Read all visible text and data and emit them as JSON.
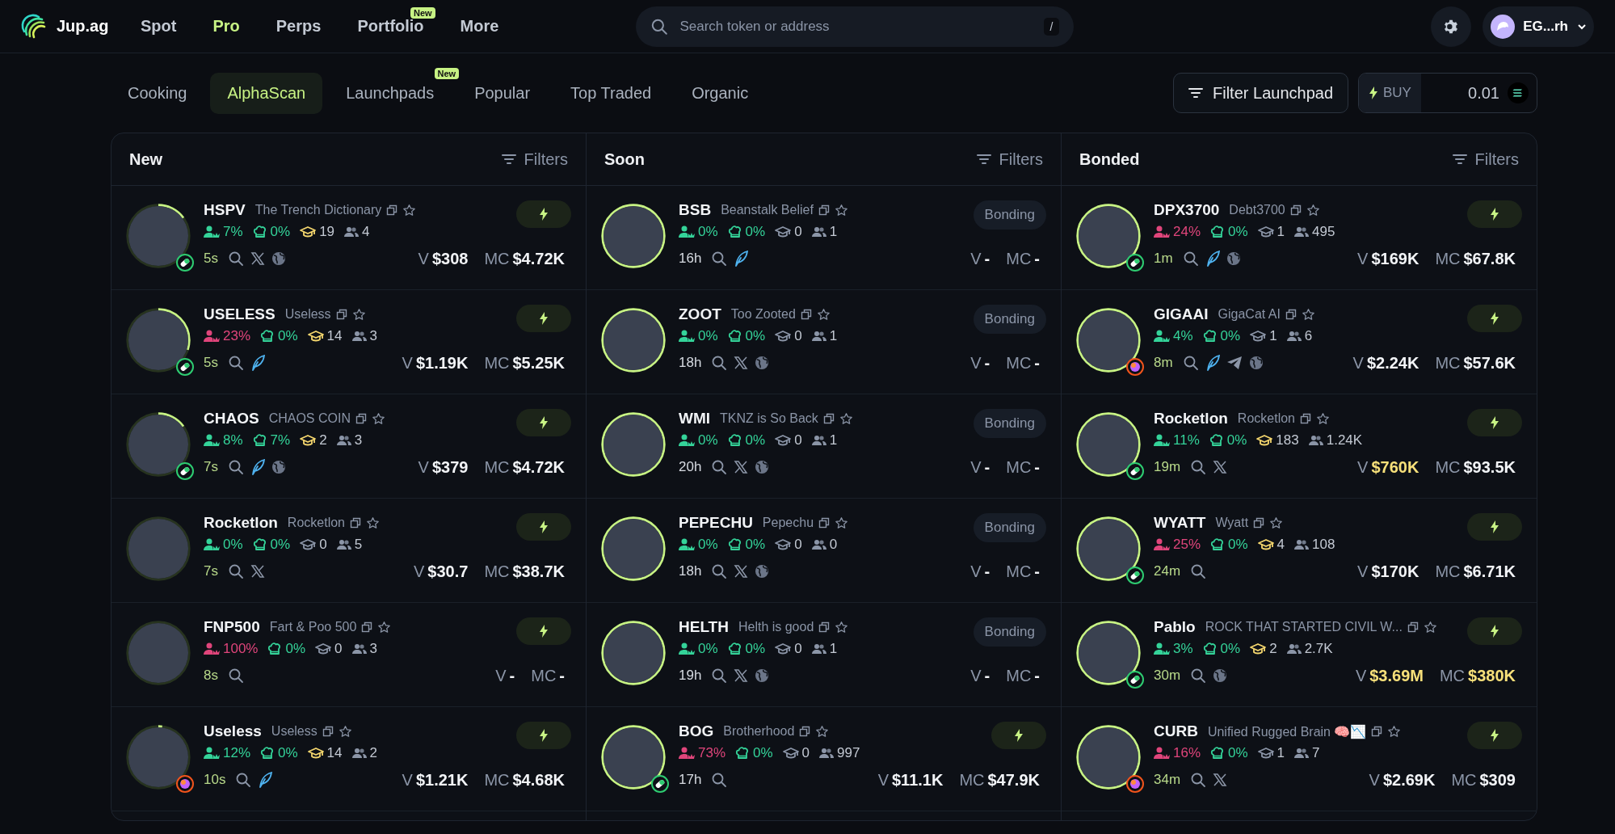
{
  "header": {
    "logo": "Jup.ag",
    "nav": [
      {
        "label": "Spot",
        "selected": false
      },
      {
        "label": "Pro",
        "selected": true
      },
      {
        "label": "Perps",
        "selected": false
      },
      {
        "label": "Portfolio",
        "selected": false,
        "badge": "New"
      },
      {
        "label": "More",
        "selected": false
      }
    ],
    "search": {
      "placeholder": "Search token or address",
      "shortcut": "/"
    },
    "account": "EG...rh"
  },
  "tabs": [
    {
      "label": "Cooking",
      "selected": false
    },
    {
      "label": "AlphaScan",
      "selected": true
    },
    {
      "label": "Launchpads",
      "selected": false,
      "badge": "New"
    },
    {
      "label": "Popular",
      "selected": false
    },
    {
      "label": "Top Traded",
      "selected": false
    },
    {
      "label": "Organic",
      "selected": false
    }
  ],
  "filter_button": "Filter Launchpad",
  "buy": {
    "label": "BUY",
    "value": "0.01"
  },
  "columns": [
    {
      "title": "New",
      "kind": "new",
      "filters": "Filters",
      "tokens": [
        {
          "symbol": "HSPV",
          "name": "The Trench Dictionary",
          "level": 0.15,
          "badge": {
            "kind": "pill"
          },
          "top_holders": {
            "value": "7%",
            "warn": false
          },
          "dev": "0%",
          "migrations": {
            "value": "19",
            "highlight": true
          },
          "holders": "4",
          "age": "5s",
          "links": [
            {
              "kind": "search"
            },
            {
              "kind": "x"
            },
            {
              "kind": "web"
            }
          ],
          "volume": {
            "label": "V",
            "value": "$308",
            "highlight": false
          },
          "mcap": {
            "label": "MC",
            "value": "$4.72K",
            "highlight": false
          },
          "action": {
            "kind": "quick_buy"
          }
        },
        {
          "symbol": "USELESS",
          "name": "Useless",
          "level": 0.3,
          "badge": {
            "kind": "pill"
          },
          "top_holders": {
            "value": "23%",
            "warn": true
          },
          "dev": "0%",
          "migrations": {
            "value": "14",
            "highlight": true
          },
          "holders": "3",
          "age": "5s",
          "links": [
            {
              "kind": "search"
            },
            {
              "kind": "feather"
            }
          ],
          "volume": {
            "label": "V",
            "value": "$1.19K",
            "highlight": false
          },
          "mcap": {
            "label": "MC",
            "value": "$5.25K",
            "highlight": false
          },
          "action": {
            "kind": "quick_buy"
          }
        },
        {
          "symbol": "CHAOS",
          "name": "CHAOS COIN",
          "level": 0.15,
          "badge": {
            "kind": "pill"
          },
          "top_holders": {
            "value": "8%",
            "warn": false
          },
          "dev": "7%",
          "migrations": {
            "value": "2",
            "highlight": true
          },
          "holders": "3",
          "age": "7s",
          "links": [
            {
              "kind": "search"
            },
            {
              "kind": "feather"
            },
            {
              "kind": "web"
            }
          ],
          "volume": {
            "label": "V",
            "value": "$379",
            "highlight": false
          },
          "mcap": {
            "label": "MC",
            "value": "$4.72K",
            "highlight": false
          },
          "action": {
            "kind": "quick_buy"
          }
        },
        {
          "symbol": "Rocketlon",
          "name": "Rocketlon",
          "level": 0,
          "top_holders": {
            "value": "0%",
            "warn": false
          },
          "dev": "0%",
          "migrations": {
            "value": "0",
            "highlight": false
          },
          "holders": "5",
          "age": "7s",
          "links": [
            {
              "kind": "search"
            },
            {
              "kind": "x"
            }
          ],
          "volume": {
            "label": "V",
            "value": "$30.7",
            "highlight": false
          },
          "mcap": {
            "label": "MC",
            "value": "$38.7K",
            "highlight": false
          },
          "action": {
            "kind": "quick_buy"
          }
        },
        {
          "symbol": "FNP500",
          "name": "Fart & Poo 500",
          "level": 0,
          "top_holders": {
            "value": "100%",
            "warn": true
          },
          "dev": "0%",
          "migrations": {
            "value": "0",
            "highlight": false
          },
          "holders": "3",
          "age": "8s",
          "links": [
            {
              "kind": "search"
            }
          ],
          "volume": {
            "label": "V",
            "value": "-",
            "highlight": false
          },
          "mcap": {
            "label": "MC",
            "value": "-",
            "highlight": false
          },
          "action": {
            "kind": "quick_buy"
          }
        },
        {
          "symbol": "Useless",
          "name": "Useless",
          "level": 0.02,
          "badge": {
            "kind": "orb"
          },
          "top_holders": {
            "value": "12%",
            "warn": false
          },
          "dev": "0%",
          "migrations": {
            "value": "14",
            "highlight": true
          },
          "holders": "2",
          "age": "10s",
          "links": [
            {
              "kind": "search"
            },
            {
              "kind": "feather"
            }
          ],
          "volume": {
            "label": "V",
            "value": "$1.21K",
            "highlight": false
          },
          "mcap": {
            "label": "MC",
            "value": "$4.68K",
            "highlight": false
          },
          "action": {
            "kind": "quick_buy"
          }
        }
      ]
    },
    {
      "title": "Soon",
      "kind": "soon",
      "filters": "Filters",
      "tokens": [
        {
          "symbol": "BSB",
          "name": "Beanstalk Belief",
          "level": 1,
          "top_holders": {
            "value": "0%",
            "warn": false
          },
          "dev": "0%",
          "migrations": {
            "value": "0",
            "highlight": false
          },
          "holders": "1",
          "age": "16h",
          "links": [
            {
              "kind": "search"
            },
            {
              "kind": "feather"
            }
          ],
          "volume": {
            "label": "V",
            "value": "-",
            "highlight": false
          },
          "mcap": {
            "label": "MC",
            "value": "-",
            "highlight": false
          },
          "action": {
            "kind": "status",
            "label": "Bonding"
          }
        },
        {
          "symbol": "ZOOT",
          "name": "Too Zooted",
          "level": 1,
          "top_holders": {
            "value": "0%",
            "warn": false
          },
          "dev": "0%",
          "migrations": {
            "value": "0",
            "highlight": false
          },
          "holders": "1",
          "age": "18h",
          "links": [
            {
              "kind": "search"
            },
            {
              "kind": "x"
            },
            {
              "kind": "web"
            }
          ],
          "volume": {
            "label": "V",
            "value": "-",
            "highlight": false
          },
          "mcap": {
            "label": "MC",
            "value": "-",
            "highlight": false
          },
          "action": {
            "kind": "status",
            "label": "Bonding"
          }
        },
        {
          "symbol": "WMI",
          "name": "TKNZ is So Back",
          "level": 1,
          "top_holders": {
            "value": "0%",
            "warn": false
          },
          "dev": "0%",
          "migrations": {
            "value": "0",
            "highlight": false
          },
          "holders": "1",
          "age": "20h",
          "links": [
            {
              "kind": "search"
            },
            {
              "kind": "x"
            },
            {
              "kind": "web"
            }
          ],
          "volume": {
            "label": "V",
            "value": "-",
            "highlight": false
          },
          "mcap": {
            "label": "MC",
            "value": "-",
            "highlight": false
          },
          "action": {
            "kind": "status",
            "label": "Bonding"
          }
        },
        {
          "symbol": "PEPECHU",
          "name": "Pepechu",
          "level": 1,
          "top_holders": {
            "value": "0%",
            "warn": false
          },
          "dev": "0%",
          "migrations": {
            "value": "0",
            "highlight": false
          },
          "holders": "0",
          "age": "18h",
          "links": [
            {
              "kind": "search"
            },
            {
              "kind": "x"
            },
            {
              "kind": "web"
            }
          ],
          "volume": {
            "label": "V",
            "value": "-",
            "highlight": false
          },
          "mcap": {
            "label": "MC",
            "value": "-",
            "highlight": false
          },
          "action": {
            "kind": "status",
            "label": "Bonding"
          }
        },
        {
          "symbol": "HELTH",
          "name": "Helth is good",
          "level": 1,
          "top_holders": {
            "value": "0%",
            "warn": false
          },
          "dev": "0%",
          "migrations": {
            "value": "0",
            "highlight": false
          },
          "holders": "1",
          "age": "19h",
          "links": [
            {
              "kind": "search"
            },
            {
              "kind": "x"
            },
            {
              "kind": "web"
            }
          ],
          "volume": {
            "label": "V",
            "value": "-",
            "highlight": false
          },
          "mcap": {
            "label": "MC",
            "value": "-",
            "highlight": false
          },
          "action": {
            "kind": "status",
            "label": "Bonding"
          }
        },
        {
          "symbol": "BOG",
          "name": "Brotherhood",
          "level": 1,
          "badge": {
            "kind": "pill"
          },
          "top_holders": {
            "value": "73%",
            "warn": true
          },
          "dev": "0%",
          "migrations": {
            "value": "0",
            "highlight": false
          },
          "holders": "997",
          "age": "17h",
          "links": [
            {
              "kind": "search"
            }
          ],
          "volume": {
            "label": "V",
            "value": "$11.1K",
            "highlight": false
          },
          "mcap": {
            "label": "MC",
            "value": "$47.9K",
            "highlight": false
          },
          "action": {
            "kind": "quick_buy"
          }
        }
      ]
    },
    {
      "title": "Bonded",
      "kind": "bonded",
      "filters": "Filters",
      "tokens": [
        {
          "symbol": "DPX3700",
          "name": "Debt3700",
          "level": 1,
          "badge": {
            "kind": "pill"
          },
          "top_holders": {
            "value": "24%",
            "warn": true
          },
          "dev": "0%",
          "migrations": {
            "value": "1",
            "highlight": false
          },
          "holders": "495",
          "age": "1m",
          "links": [
            {
              "kind": "search"
            },
            {
              "kind": "feather"
            },
            {
              "kind": "web"
            }
          ],
          "volume": {
            "label": "V",
            "value": "$169K",
            "highlight": false
          },
          "mcap": {
            "label": "MC",
            "value": "$67.8K",
            "highlight": false
          },
          "action": {
            "kind": "quick_buy"
          }
        },
        {
          "symbol": "GIGAAI",
          "name": "GigaCat AI",
          "level": 1,
          "badge": {
            "kind": "orb"
          },
          "top_holders": {
            "value": "4%",
            "warn": false
          },
          "dev": "0%",
          "migrations": {
            "value": "1",
            "highlight": false
          },
          "holders": "6",
          "age": "8m",
          "links": [
            {
              "kind": "search"
            },
            {
              "kind": "feather"
            },
            {
              "kind": "telegram"
            },
            {
              "kind": "web"
            }
          ],
          "volume": {
            "label": "V",
            "value": "$2.24K",
            "highlight": false
          },
          "mcap": {
            "label": "MC",
            "value": "$57.6K",
            "highlight": false
          },
          "action": {
            "kind": "quick_buy"
          }
        },
        {
          "symbol": "Rocketlon",
          "name": "Rocketlon",
          "level": 1,
          "badge": {
            "kind": "pill"
          },
          "top_holders": {
            "value": "11%",
            "warn": false
          },
          "dev": "0%",
          "migrations": {
            "value": "183",
            "highlight": true
          },
          "holders": "1.24K",
          "age": "19m",
          "links": [
            {
              "kind": "search"
            },
            {
              "kind": "x"
            }
          ],
          "volume": {
            "label": "V",
            "value": "$760K",
            "highlight": true
          },
          "mcap": {
            "label": "MC",
            "value": "$93.5K",
            "highlight": false
          },
          "action": {
            "kind": "quick_buy"
          }
        },
        {
          "symbol": "WYATT",
          "name": "Wyatt",
          "level": 1,
          "badge": {
            "kind": "pill"
          },
          "top_holders": {
            "value": "25%",
            "warn": true
          },
          "dev": "0%",
          "migrations": {
            "value": "4",
            "highlight": true
          },
          "holders": "108",
          "age": "24m",
          "links": [
            {
              "kind": "search"
            }
          ],
          "volume": {
            "label": "V",
            "value": "$170K",
            "highlight": false
          },
          "mcap": {
            "label": "MC",
            "value": "$6.71K",
            "highlight": false
          },
          "action": {
            "kind": "quick_buy"
          }
        },
        {
          "symbol": "Pablo",
          "name": "ROCK THAT STARTED CIVIL W...",
          "level": 1,
          "badge": {
            "kind": "pill"
          },
          "top_holders": {
            "value": "3%",
            "warn": false
          },
          "dev": "0%",
          "migrations": {
            "value": "2",
            "highlight": true
          },
          "holders": "2.7K",
          "age": "30m",
          "links": [
            {
              "kind": "search"
            },
            {
              "kind": "web"
            }
          ],
          "volume": {
            "label": "V",
            "value": "$3.69M",
            "highlight": true
          },
          "mcap": {
            "label": "MC",
            "value": "$380K",
            "highlight": true
          },
          "action": {
            "kind": "quick_buy"
          }
        },
        {
          "symbol": "CURB",
          "name": "Unified Rugged Brain 🧠📉",
          "level": 1,
          "badge": {
            "kind": "orb"
          },
          "top_holders": {
            "value": "16%",
            "warn": true
          },
          "dev": "0%",
          "migrations": {
            "value": "1",
            "highlight": false
          },
          "holders": "7",
          "age": "34m",
          "links": [
            {
              "kind": "search"
            },
            {
              "kind": "x"
            }
          ],
          "volume": {
            "label": "V",
            "value": "$2.69K",
            "highlight": false
          },
          "mcap": {
            "label": "MC",
            "value": "$309",
            "highlight": false
          },
          "action": {
            "kind": "quick_buy"
          }
        }
      ]
    }
  ]
}
